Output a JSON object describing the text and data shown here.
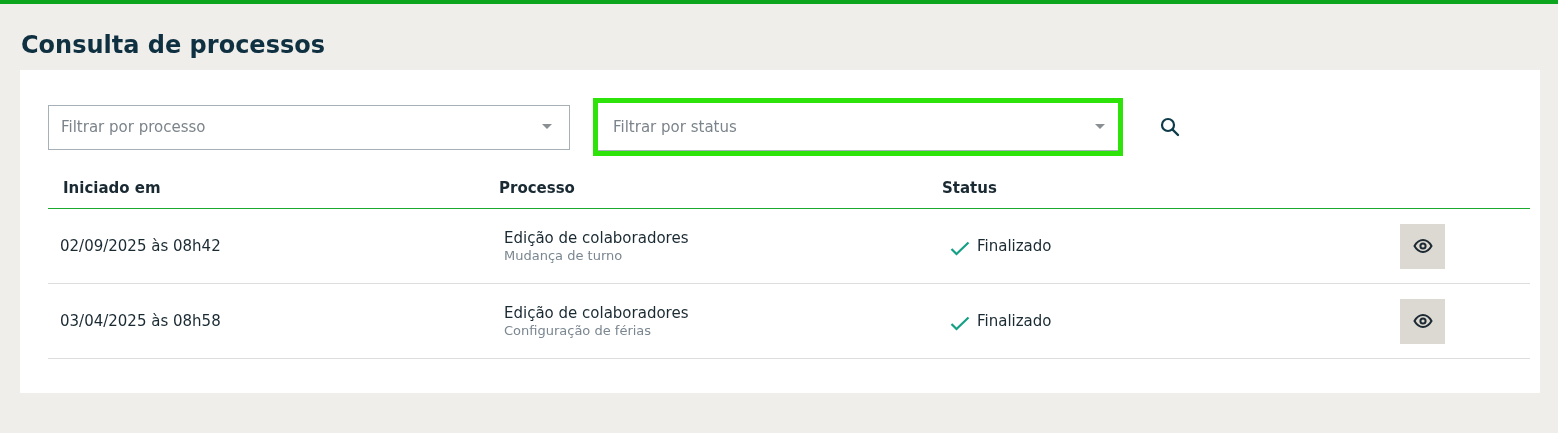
{
  "page_title": "Consulta de processos",
  "filters": [
    {
      "placeholder": "Filtrar por processo",
      "highlighted": false
    },
    {
      "placeholder": "Filtrar por status",
      "highlighted": true
    }
  ],
  "table": {
    "columns": [
      "Iniciado em",
      "Processo",
      "Status"
    ],
    "rows": [
      {
        "started": "02/09/2025 às 08h42",
        "process": "Edição de colaboradores",
        "detail": "Mudança de turno",
        "status": "Finalizado",
        "kind": "done"
      },
      {
        "started": "03/04/2025 às 08h58",
        "process": "Edição de colaboradores",
        "detail": "Configuração de férias",
        "status": "Finalizado",
        "kind": "done"
      }
    ]
  }
}
